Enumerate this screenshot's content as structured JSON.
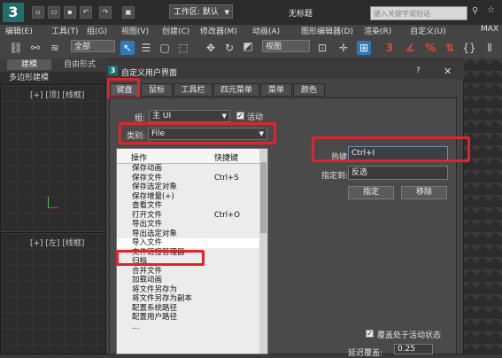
{
  "app": {
    "workspace_label": "工作区: 默认",
    "window_title": "无标题",
    "search_placeholder": "键入关键字或短语"
  },
  "menubar": [
    "编辑(E)",
    "工具(T)",
    "组(G)",
    "视图(V)",
    "创建(C)",
    "修改器(M)",
    "动画(A)",
    "图形编辑器(D)",
    "渲染(R)",
    "自定义(U)",
    "MAX"
  ],
  "toolbar": {
    "selection_filter": "全部",
    "ref_coord": "视图"
  },
  "ribbon": {
    "tabs": [
      "建模",
      "自由形式"
    ],
    "label": "多边形建模"
  },
  "viewports": {
    "top_left_label": "[+] [顶] [线框]",
    "bottom_left_label": "[+] [左] [线框]"
  },
  "dialog": {
    "title": "自定义用户界面",
    "help": "?",
    "close": "✕",
    "tabs": [
      "键盘",
      "鼠标",
      "工具栏",
      "四元菜单",
      "菜单",
      "颜色"
    ],
    "group_label": "组:",
    "group_value": "主 UI",
    "active_label": "活动",
    "category_label": "类别:",
    "category_value": "File",
    "list_headers": {
      "action": "操作",
      "shortcut": "快捷键"
    },
    "actions": [
      {
        "name": "保存动画",
        "key": ""
      },
      {
        "name": "保存文件",
        "key": "Ctrl+S"
      },
      {
        "name": "保存选定对象",
        "key": ""
      },
      {
        "name": "保存增量(+)",
        "key": ""
      },
      {
        "name": "查看文件",
        "key": ""
      },
      {
        "name": "打开文件",
        "key": "Ctrl+O"
      },
      {
        "name": "导出文件",
        "key": ""
      },
      {
        "name": "导出选定对象",
        "key": ""
      },
      {
        "name": "导入文件",
        "key": ""
      },
      {
        "name": "文件链接管理器",
        "key": ""
      },
      {
        "name": "归档",
        "key": ""
      },
      {
        "name": "合并文件",
        "key": ""
      },
      {
        "name": "加载动画",
        "key": ""
      },
      {
        "name": "将文件另存为",
        "key": ""
      },
      {
        "name": "将文件另存为副本",
        "key": ""
      },
      {
        "name": "配置系统路径",
        "key": ""
      },
      {
        "name": "配置用户路径",
        "key": ""
      },
      {
        "name": "…",
        "key": ""
      }
    ],
    "hotkey_label": "热键:",
    "hotkey_value": "Ctrl+I",
    "assigned_label": "指定到:",
    "assigned_value": "反选",
    "assign_button": "指定",
    "remove_button": "移除",
    "override_label": "覆盖处于活动状态",
    "delay_label": "延迟覆盖:",
    "delay_value": "0.25"
  },
  "colors": {
    "highlight": "#e0242c",
    "accent": "#2e7ab8",
    "app_logo": "#1f6f6a"
  }
}
